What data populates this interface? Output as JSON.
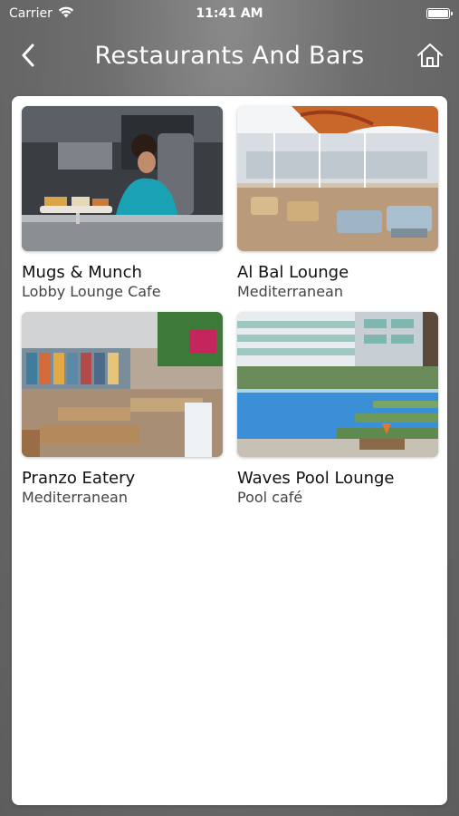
{
  "status_bar": {
    "carrier": "Carrier",
    "time": "11:41 AM"
  },
  "nav": {
    "title": "Restaurants And Bars",
    "back_icon": "chevron-left-icon",
    "home_icon": "home-icon"
  },
  "venues": [
    {
      "name": "Mugs & Munch",
      "category": "Lobby Lounge Cafe"
    },
    {
      "name": "Al Bal Lounge",
      "category": "Mediterranean"
    },
    {
      "name": "Pranzo Eatery",
      "category": "Mediterranean"
    },
    {
      "name": "Waves Pool Lounge",
      "category": "Pool café"
    }
  ],
  "colors": {
    "background": "#6e6e6e",
    "card": "#ffffff",
    "text_primary": "#111111",
    "text_secondary": "#444444"
  }
}
